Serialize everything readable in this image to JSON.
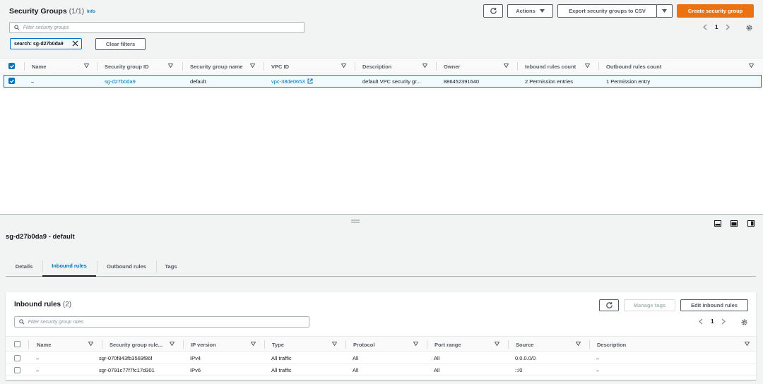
{
  "header": {
    "title": "Security Groups",
    "count": "(1/1)",
    "info": "Info",
    "actions_label": "Actions",
    "export_label": "Export security groups to CSV",
    "create_label": "Create security group"
  },
  "search": {
    "placeholder": "Filter security groups",
    "token": "search: sg-d27b0da9",
    "clear_label": "Clear filters"
  },
  "pagination": {
    "page": "1"
  },
  "groups_table": {
    "columns": [
      "Name",
      "Security group ID",
      "Security group name",
      "VPC ID",
      "Description",
      "Owner",
      "Inbound rules count",
      "Outbound rules count"
    ],
    "rows": [
      [
        "–",
        "sg-d27b0da9",
        "default",
        "vpc-38de0653",
        "default VPC security gr...",
        "886452391640",
        "2 Permission entries",
        "1 Permission entry"
      ]
    ]
  },
  "detail": {
    "title": "sg-d27b0da9 - default",
    "tabs": [
      "Details",
      "Inbound rules",
      "Outbound rules",
      "Tags"
    ],
    "active_tab": "Inbound rules"
  },
  "inbound": {
    "title": "Inbound rules",
    "count": "(2)",
    "manage_tags_label": "Manage tags",
    "edit_label": "Edit inbound rules",
    "placeholder": "Filter security group rules",
    "page": "1",
    "columns": [
      "Name",
      "Security group rule...",
      "IP version",
      "Type",
      "Protocol",
      "Port range",
      "Source",
      "Description"
    ],
    "rows": [
      [
        "–",
        "sgr-070f843fb3569f86f",
        "IPv4",
        "All traffic",
        "All",
        "All",
        "0.0.0.0/0",
        "–"
      ],
      [
        "–",
        "sgr-0791c77f7fc17d301",
        "IPv6",
        "All traffic",
        "All",
        "All",
        "::/0",
        "–"
      ]
    ]
  },
  "colors": {
    "primary": "#ec7211",
    "link": "#0073bb",
    "background": "#f2f3f3"
  }
}
